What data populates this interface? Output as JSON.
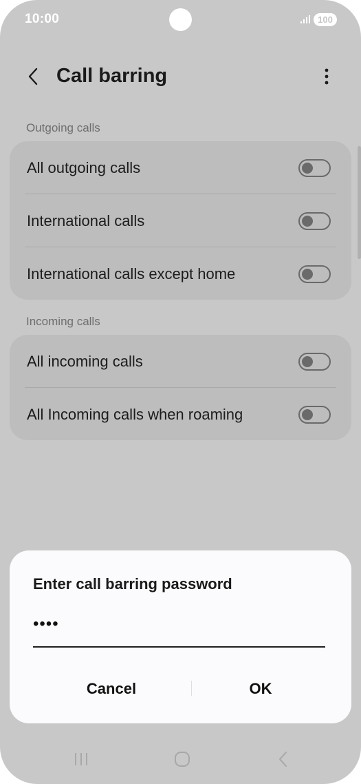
{
  "status_bar": {
    "time": "10:00",
    "battery": "100"
  },
  "header": {
    "title": "Call barring"
  },
  "sections": [
    {
      "title": "Outgoing calls",
      "items": [
        {
          "label": "All outgoing calls",
          "on": false
        },
        {
          "label": "International calls",
          "on": false
        },
        {
          "label": "International calls except home",
          "on": false
        }
      ]
    },
    {
      "title": "Incoming calls",
      "items": [
        {
          "label": "All incoming calls",
          "on": false
        },
        {
          "label": "All Incoming calls when roaming",
          "on": false
        }
      ]
    }
  ],
  "dialog": {
    "title": "Enter call barring password",
    "password_value": "••••",
    "cancel_label": "Cancel",
    "ok_label": "OK"
  },
  "nav": {
    "icons": [
      "recents-icon",
      "home-icon",
      "back-icon"
    ]
  },
  "colors": {
    "background": "#c8c8c8",
    "card": "#bdbdbd",
    "dialog": "#fbfbfd",
    "toggle_off": "#6a6a6a"
  }
}
